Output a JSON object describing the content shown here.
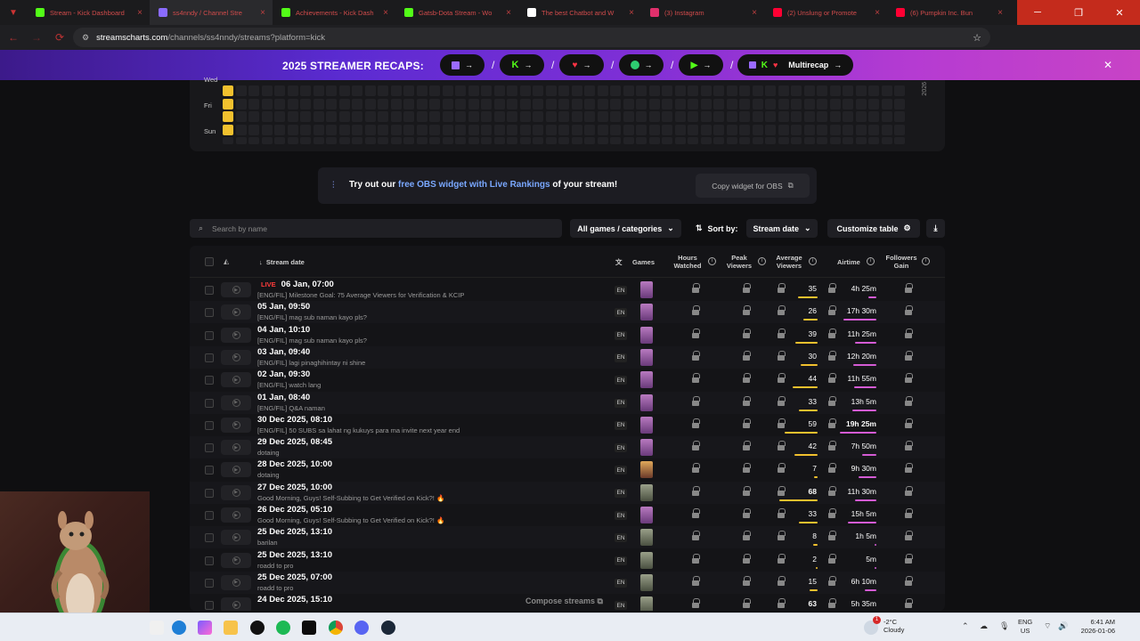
{
  "browser": {
    "tabs": [
      {
        "title": "Stream - Kick Dashboard",
        "icon": "kick-icon",
        "color": "#53fc18"
      },
      {
        "title": "ss4nndy / Channel Stre",
        "icon": "streamscharts-icon",
        "color": "#8a6bff"
      },
      {
        "title": "Achievements - Kick Dash",
        "icon": "kick-icon",
        "color": "#53fc18"
      },
      {
        "title": "Gatsb-Dota Stream - Wo",
        "icon": "kick-icon",
        "color": "#53fc18"
      },
      {
        "title": "The best Chatbot and W",
        "icon": "chatbot-icon",
        "color": "#ffffff"
      },
      {
        "title": "(3) Instagram",
        "icon": "instagram-icon",
        "color": "#e1306c"
      },
      {
        "title": "(2) Unslung or Promote",
        "icon": "youtube-icon",
        "color": "#ff0033"
      },
      {
        "title": "(6) Pumpkin Inc. Bun",
        "icon": "youtube-icon",
        "color": "#ff0033"
      }
    ],
    "new_tab": "+",
    "url_host": "streamscharts.com",
    "url_path": "/channels/ss4nndy/streams?platform=kick"
  },
  "banner": {
    "title": "2025 STREAMER RECAPS:",
    "multirecap": "Multirecap",
    "close": "✕"
  },
  "heatmap": {
    "days": [
      "Wed",
      "Fri",
      "Sun"
    ],
    "year": "2026",
    "active_rows": [
      0,
      1,
      2,
      3
    ]
  },
  "obs": {
    "pre": "Try out our ",
    "link": "free OBS widget with Live Rankings",
    "post": " of your stream!",
    "button": "Copy widget for OBS"
  },
  "toolbar": {
    "search_placeholder": "Search by name",
    "games_filter": "All games / categories",
    "sort_by_label": "Sort by:",
    "sort_value": "Stream date",
    "customize": "Customize table"
  },
  "table": {
    "headers": {
      "stream_date": "Stream date",
      "games": "Games",
      "hours_watched": "Hours Watched",
      "peak_viewers": "Peak Viewers",
      "average_viewers": "Average Viewers",
      "airtime": "Airtime",
      "followers_gain": "Followers Gain"
    },
    "rows": [
      {
        "live": "LIVE",
        "date": "06 Jan, 07:00",
        "title": "[ENG/FIL] Milestone Goal: 75 Average Viewers for Verification & KCIP",
        "lang": "EN",
        "game": "dota",
        "avg": "35",
        "air": "4h 25m"
      },
      {
        "live": "",
        "date": "05 Jan, 09:50",
        "title": "[ENG/FIL] mag sub naman kayo pls?",
        "lang": "EN",
        "game": "dota",
        "avg": "26",
        "air": "17h 30m"
      },
      {
        "live": "",
        "date": "04 Jan, 10:10",
        "title": "[ENG/FIL] mag sub naman kayo pls?",
        "lang": "EN",
        "game": "dota",
        "avg": "39",
        "air": "11h 25m"
      },
      {
        "live": "",
        "date": "03 Jan, 09:40",
        "title": "[ENG/FIL] lagi pinaghihintay ni shine",
        "lang": "EN",
        "game": "dota",
        "avg": "30",
        "air": "12h 20m"
      },
      {
        "live": "",
        "date": "02 Jan, 09:30",
        "title": "[ENG/FIL] watch lang",
        "lang": "EN",
        "game": "dota",
        "avg": "44",
        "air": "11h 55m"
      },
      {
        "live": "",
        "date": "01 Jan, 08:40",
        "title": "[ENG/FIL] Q&A naman",
        "lang": "EN",
        "game": "dota",
        "avg": "33",
        "air": "13h 5m"
      },
      {
        "live": "",
        "date": "30 Dec 2025, 08:10",
        "title": "[ENG/FIL] 50 SUBS sa lahat ng kukuys para ma invite next year end",
        "lang": "EN",
        "game": "dota",
        "avg": "59",
        "air": "19h 25m"
      },
      {
        "live": "",
        "date": "29 Dec 2025, 08:45",
        "title": "dotaing",
        "lang": "EN",
        "game": "dota",
        "avg": "42",
        "air": "7h 50m"
      },
      {
        "live": "",
        "date": "28 Dec 2025, 10:00",
        "title": "dotaing",
        "lang": "EN",
        "game": "other",
        "avg": "7",
        "air": "9h 30m"
      },
      {
        "live": "",
        "date": "27 Dec 2025, 10:00",
        "title": "Good Morning, Guys! Self-Subbing to Get Verified on Kick?! 🔥",
        "lang": "EN",
        "game": "just",
        "avg": "68",
        "air": "11h 30m"
      },
      {
        "live": "",
        "date": "26 Dec 2025, 05:10",
        "title": "Good Morning, Guys! Self-Subbing to Get Verified on Kick?! 🔥",
        "lang": "EN",
        "game": "dota",
        "avg": "33",
        "air": "15h 5m"
      },
      {
        "live": "",
        "date": "25 Dec 2025, 13:10",
        "title": "barilan",
        "lang": "EN",
        "game": "just",
        "avg": "8",
        "air": "1h 5m"
      },
      {
        "live": "",
        "date": "25 Dec 2025, 13:10",
        "title": "roadd to pro",
        "lang": "EN",
        "game": "just",
        "avg": "2",
        "air": "5m"
      },
      {
        "live": "",
        "date": "25 Dec 2025, 07:00",
        "title": "roadd to pro",
        "lang": "EN",
        "game": "just",
        "avg": "15",
        "air": "6h 10m"
      },
      {
        "live": "",
        "date": "24 Dec 2025, 15:10",
        "title": "",
        "lang": "EN",
        "game": "just",
        "avg": "63",
        "air": "5h 35m"
      }
    ],
    "compose": "Compose streams"
  },
  "taskbar": {
    "temp": "-2°C",
    "weather": "Cloudy",
    "lang_1": "ENG",
    "lang_2": "US",
    "time": "6:41 AM",
    "date": "2026-01-06",
    "badge": "1"
  },
  "colors": {
    "accent_yellow": "#f2c12e",
    "accent_pink": "#d45bd4",
    "live_red": "#ff3b3b",
    "link_blue": "#7aa8ff"
  }
}
